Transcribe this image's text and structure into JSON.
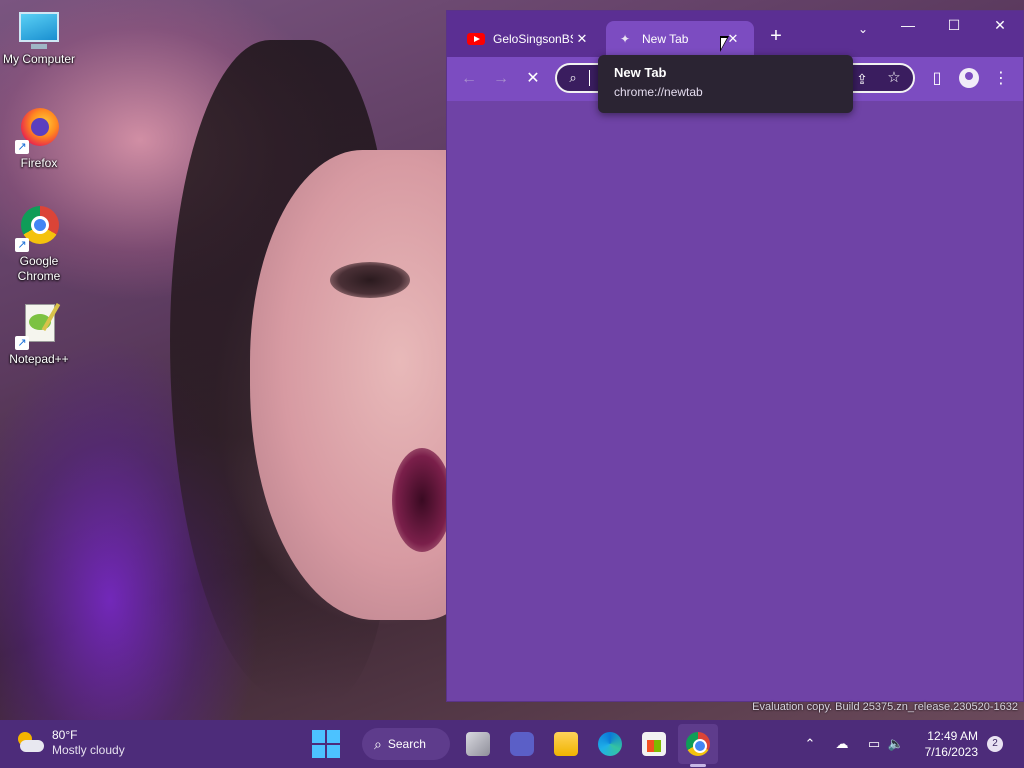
{
  "desktop": {
    "icons": [
      {
        "label": "My Computer",
        "icon": "monitor-icon"
      },
      {
        "label": "Firefox",
        "icon": "firefox-icon"
      },
      {
        "label": "Google Chrome",
        "icon": "chrome-icon"
      },
      {
        "label": "Notepad++",
        "icon": "notepadpp-icon"
      }
    ],
    "watermark": "Evaluation copy. Build 25375.zn_release.230520-1632"
  },
  "browser": {
    "tabs": [
      {
        "title": "GeloSingsonBSC",
        "icon": "youtube-icon",
        "active": false
      },
      {
        "title": "New Tab",
        "icon": "newtab-icon",
        "active": true
      }
    ],
    "new_tab_symbol": "+",
    "window_controls": {
      "tab_search": "⌄",
      "minimize": "—",
      "maximize": "☐",
      "close": "✕"
    },
    "toolbar": {
      "back": "←",
      "forward": "→",
      "stop": "✕",
      "omnibox_value": "",
      "share": "⇪",
      "star": "☆",
      "side_panel": "▯",
      "menu": "⋮"
    },
    "tooltip": {
      "title": "New Tab",
      "url": "chrome://newtab"
    },
    "page_background": "#6f43a6"
  },
  "taskbar": {
    "weather": {
      "temp": "80°F",
      "condition": "Mostly cloudy"
    },
    "search_label": "Search",
    "apps": [
      "task-view",
      "meet",
      "file-explorer",
      "edge",
      "microsoft-store",
      "chrome"
    ],
    "active_app": "chrome",
    "tray": {
      "chevron": "⌃",
      "network": "☁",
      "display": "▭",
      "volume": "🔈"
    },
    "clock": {
      "time": "12:49 AM",
      "date": "7/16/2023"
    },
    "notifications": "2"
  }
}
